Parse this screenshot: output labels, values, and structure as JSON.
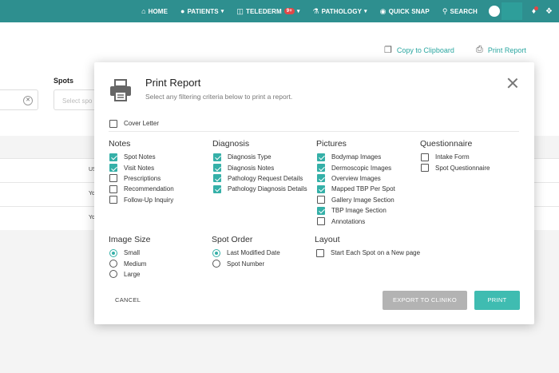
{
  "nav": {
    "home": "HOME",
    "patients": "PATIENTS",
    "telederm": "TELEDERM",
    "telederm_badge": "9+",
    "pathology": "PATHOLOGY",
    "quick_snap": "QUICK SNAP",
    "search": "SEARCH"
  },
  "background": {
    "copy_to_clipboard": "Copy to Clipboard",
    "print_report": "Print Report",
    "spots_label": "Spots",
    "spots_placeholder": "Select spo",
    "row_texts": [
      "US",
      "Yo",
      "Yo"
    ]
  },
  "modal": {
    "title": "Print Report",
    "subtitle": "Select any filtering criteria below to print a report.",
    "cover_letter": {
      "label": "Cover Letter",
      "checked": false
    },
    "notes": {
      "title": "Notes",
      "items": [
        {
          "label": "Spot Notes",
          "checked": true
        },
        {
          "label": "Visit Notes",
          "checked": true
        },
        {
          "label": "Prescriptions",
          "checked": false
        },
        {
          "label": "Recommendation",
          "checked": false
        },
        {
          "label": "Follow-Up Inquiry",
          "checked": false
        }
      ]
    },
    "diagnosis": {
      "title": "Diagnosis",
      "items": [
        {
          "label": "Diagnosis Type",
          "checked": true
        },
        {
          "label": "Diagnosis Notes",
          "checked": true
        },
        {
          "label": "Pathology Request Details",
          "checked": true
        },
        {
          "label": "Pathology Diagnosis Details",
          "checked": true
        }
      ]
    },
    "pictures": {
      "title": "Pictures",
      "items": [
        {
          "label": "Bodymap Images",
          "checked": true
        },
        {
          "label": "Dermoscopic Images",
          "checked": true
        },
        {
          "label": "Overview Images",
          "checked": true
        },
        {
          "label": "Mapped TBP Per Spot",
          "checked": true
        },
        {
          "label": "Gallery Image Section",
          "checked": false
        },
        {
          "label": "TBP Image Section",
          "checked": true
        },
        {
          "label": "Annotations",
          "checked": false
        }
      ]
    },
    "questionnaire": {
      "title": "Questionnaire",
      "items": [
        {
          "label": "Intake Form",
          "checked": false
        },
        {
          "label": "Spot Questionnaire",
          "checked": false
        }
      ]
    },
    "image_size": {
      "title": "Image Size",
      "options": [
        {
          "label": "Small",
          "selected": true
        },
        {
          "label": "Medium",
          "selected": false
        },
        {
          "label": "Large",
          "selected": false
        }
      ]
    },
    "spot_order": {
      "title": "Spot Order",
      "options": [
        {
          "label": "Last Modified Date",
          "selected": true
        },
        {
          "label": "Spot Number",
          "selected": false
        }
      ]
    },
    "layout": {
      "title": "Layout",
      "items": [
        {
          "label": "Start Each Spot on a New page",
          "checked": false
        }
      ]
    },
    "buttons": {
      "cancel": "CANCEL",
      "export": "EXPORT TO CLINIKO",
      "print": "PRINT"
    }
  },
  "colors": {
    "nav_bg": "#2e8f8f",
    "accent": "#3fbcb1",
    "link": "#2aa6a0",
    "disabled_button": "#b3b3b3",
    "badge": "#e04848"
  }
}
